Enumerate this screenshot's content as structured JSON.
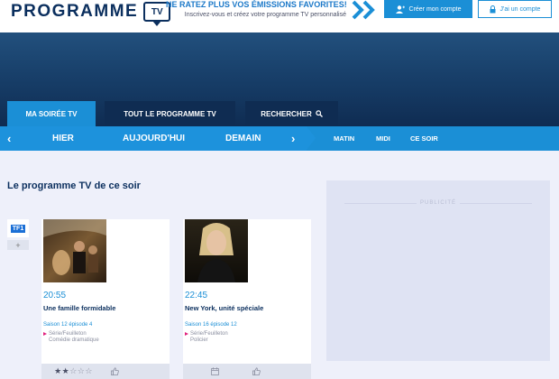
{
  "header": {
    "logo_text": "PROGRAMME",
    "logo_badge": "TV",
    "promo_title": "NE RATEZ PLUS VOS ÉMISSIONS FAVORITES!",
    "promo_subtitle": "Inscrivez-vous et créez votre programme TV personnalisé",
    "create_account_label": "Créer mon compte",
    "have_account_label": "J'ai un compte"
  },
  "nav": {
    "tabs": [
      {
        "label": "MA SOIRÉE TV",
        "active": true
      },
      {
        "label": "TOUT LE PROGRAMME TV",
        "active": false
      },
      {
        "label": "RECHERCHER",
        "active": false
      }
    ],
    "days": [
      "HIER",
      "AUJOURD'HUI",
      "DEMAIN"
    ],
    "slots": [
      "MATIN",
      "MIDI",
      "CE SOIR"
    ]
  },
  "main": {
    "section_title": "Le programme TV de ce soir",
    "channel_logo": "TF1",
    "channel_more": "+",
    "programs": [
      {
        "time": "20:55",
        "title": "Une famille formidable",
        "season": "Saison 12 épisode 4",
        "genre_line1": "Série/Feuilleton",
        "genre_line2": "Comédie dramatique",
        "rating": 2
      },
      {
        "time": "22:45",
        "title": "New York, unité spéciale",
        "season": "Saison 16 épisode 12",
        "genre_line1": "Série/Feuilleton",
        "genre_line2": "Policier"
      }
    ]
  },
  "ad": {
    "label": "PUBLICITÉ"
  },
  "colors": {
    "accent": "#1b8fd6",
    "navy": "#0f2c52",
    "genre_marker": "#e0207e"
  }
}
